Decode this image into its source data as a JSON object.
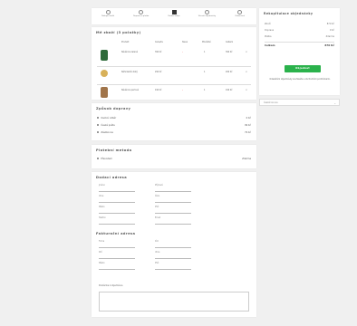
{
  "steps": [
    {
      "label": "Nákupní košík",
      "icon": "cart-icon"
    },
    {
      "label": "Doprava a platba",
      "icon": "truck-icon"
    },
    {
      "label": "Dodací údaje",
      "icon": "address-icon"
    },
    {
      "label": "Shrnutí objednávky",
      "icon": "summary-icon"
    },
    {
      "label": "Dokončení",
      "icon": "check-icon"
    }
  ],
  "cart": {
    "title": "Mé zboží (3 položky)",
    "columns": [
      "Produkt",
      "Cena/ks",
      "Sleva",
      "Množství",
      "Celkem"
    ],
    "items": [
      {
        "name": "Náušnice zelené",
        "price": "390 Kč",
        "discount": "–",
        "qty": "1",
        "total": "390 Kč",
        "color": "#2f6b3a"
      },
      {
        "name": "Náhrdelník zlatý",
        "price": "290 Kč",
        "discount": "",
        "qty": "1",
        "total": "290 Kč",
        "color": "#d8b15a"
      },
      {
        "name": "Náušnice perlové",
        "price": "190 Kč",
        "discount": "–",
        "qty": "1",
        "total": "190 Kč",
        "color": "#a0744a"
      }
    ]
  },
  "shipping": {
    "title": "Způsob dopravy",
    "options": [
      {
        "label": "Osobní odběr",
        "price": "0 Kč"
      },
      {
        "label": "Česká pošta",
        "price": "99 Kč"
      },
      {
        "label": "Zásilkovna",
        "price": "79 Kč"
      }
    ]
  },
  "payment": {
    "title": "Platební metoda",
    "options": [
      {
        "label": "Převodem",
        "price": "Zdarma"
      }
    ]
  },
  "delivery": {
    "title": "Dodací adresa",
    "fields": [
      "Jméno",
      "Příjmení",
      "Ulice",
      "Číslo",
      "Město",
      "PSČ",
      "Telefon",
      "Email"
    ]
  },
  "billing": {
    "title": "Fakturační adresa",
    "fields": [
      "Firma",
      "IČO",
      "DIČ",
      "Ulice",
      "Město",
      "PSČ"
    ]
  },
  "note": {
    "label": "Poznámka k objednávce"
  },
  "summary": {
    "title": "Rekapitulace objednávky",
    "rows": [
      {
        "label": "Zboží",
        "value": "870 Kč"
      },
      {
        "label": "Doprava",
        "value": "0 Kč"
      },
      {
        "label": "Platba",
        "value": "Zdarma"
      }
    ],
    "total_label": "Celkem",
    "total_value": "870 Kč",
    "button": "Objednat",
    "terms": "Odesláním objednávky souhlasíte s obchodními podmínkami."
  },
  "currency": {
    "selected": "Česká koruna"
  }
}
